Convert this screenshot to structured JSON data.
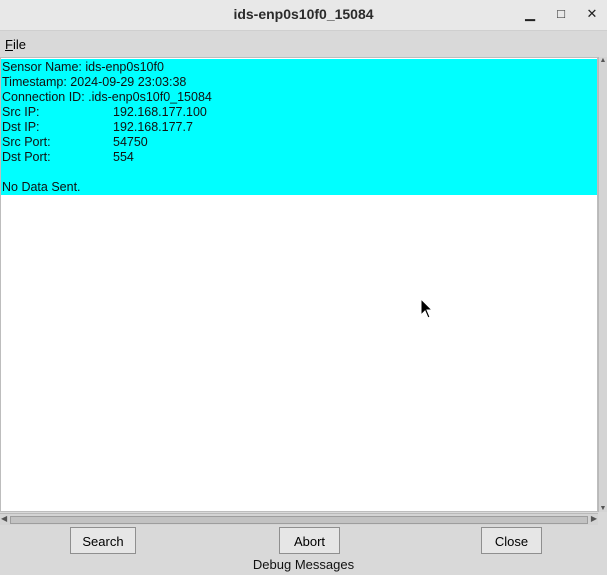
{
  "window": {
    "title": "ids-enp0s10f0_15084",
    "min_glyph": "▁",
    "max_glyph": "□",
    "close_glyph": "✕"
  },
  "menu": {
    "file_first": "F",
    "file_rest": "ile"
  },
  "details": {
    "sensor_line": "Sensor Name: ids-enp0s10f0",
    "timestamp_line": "Timestamp: 2024-09-29 23:03:38",
    "connection_line": "Connection ID: .ids-enp0s10f0_15084",
    "src_ip_label": "Src IP:",
    "src_ip": "192.168.177.100",
    "dst_ip_label": "Dst IP:",
    "dst_ip": "192.168.177.7",
    "src_port_label": "Src Port:",
    "src_port": "54750",
    "dst_port_label": "Dst Port:",
    "dst_port": "554",
    "message": "No Data Sent."
  },
  "buttons": {
    "search": "Search",
    "abort": "Abort",
    "close": "Close"
  },
  "status": "Debug Messages",
  "colors": {
    "highlight": "#00ffff",
    "background": "#d9d9d9"
  }
}
